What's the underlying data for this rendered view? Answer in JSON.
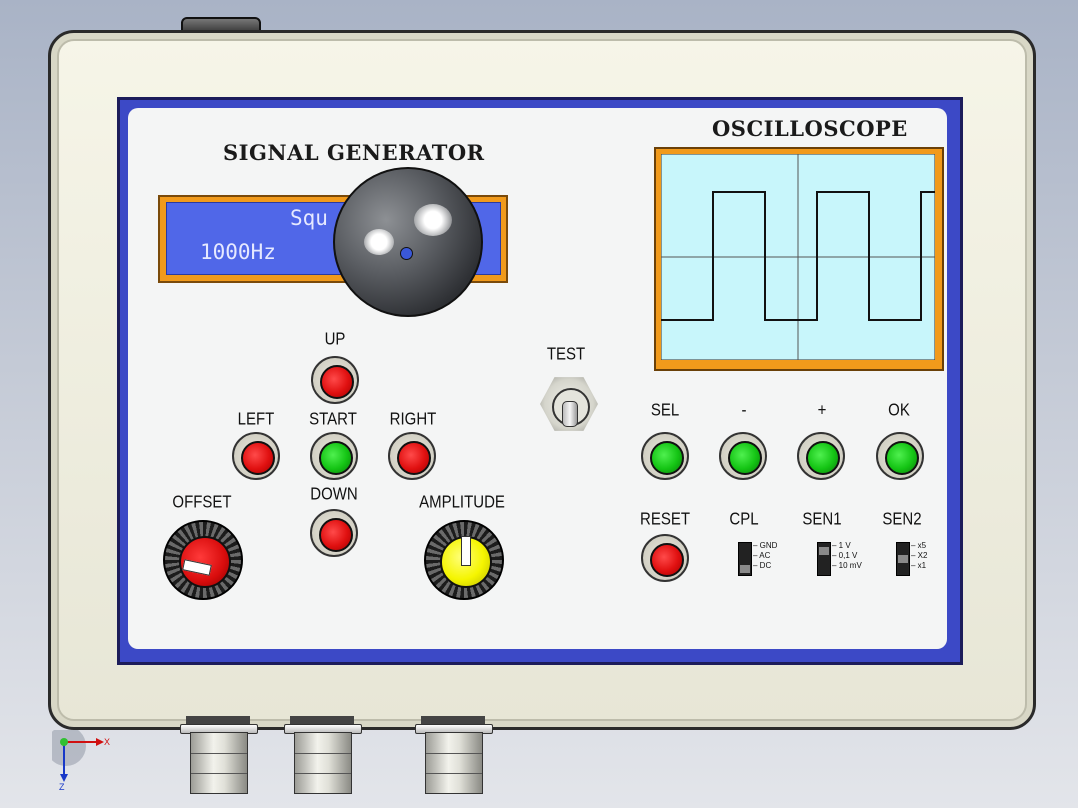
{
  "signal_generator": {
    "title": "SIGNAL GENERATOR",
    "lcd_line1": "Squ",
    "lcd_line2": "1000Hz",
    "buttons": {
      "up": "UP",
      "left": "LEFT",
      "start": "START",
      "right": "RIGHT",
      "down": "DOWN"
    },
    "offset_label": "OFFSET",
    "amplitude_label": "AMPLITUDE",
    "test_label": "TEST"
  },
  "oscilloscope": {
    "title": "OSCILLOSCOPE",
    "screen_color": "#c8f6fb",
    "frame_color": "#f19a1b",
    "buttons": {
      "sel": "SEL",
      "minus": "-",
      "plus": "+",
      "ok": "OK",
      "reset": "RESET"
    },
    "switches": {
      "cpl": {
        "label": "CPL",
        "options": [
          "GND",
          "AC",
          "DC"
        ]
      },
      "sen1": {
        "label": "SEN1",
        "options": [
          "1 V",
          "0,1 V",
          "10 mV"
        ]
      },
      "sen2": {
        "label": "SEN2",
        "options": [
          "x5",
          "X2",
          "x1"
        ]
      }
    }
  },
  "axis": {
    "x": "X",
    "z": "Z"
  },
  "colors": {
    "panel_blue": "#3c49c6",
    "lcd_blue": "#5067e8",
    "button_red": "#e01010",
    "button_green": "#14c414",
    "knob_yellow": "#f5f500"
  }
}
